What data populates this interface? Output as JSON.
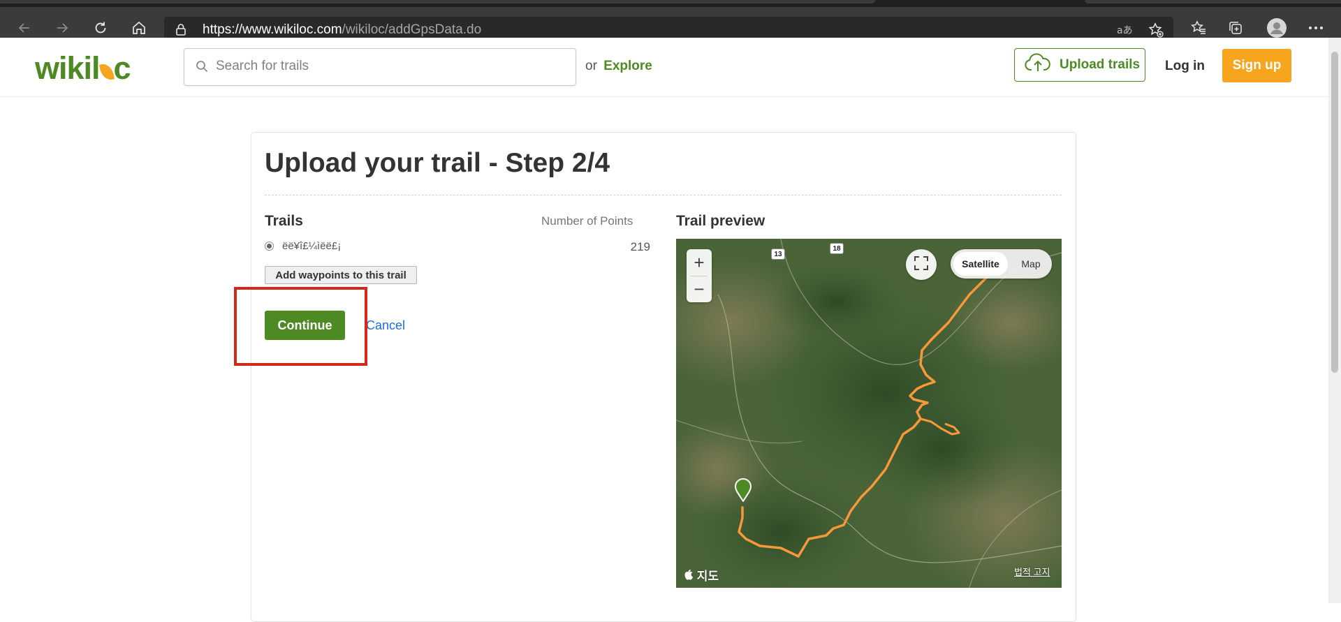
{
  "browser": {
    "url_main": "https://www.wikiloc.com",
    "url_path": "/wikiloc/addGpsData.do",
    "icons": [
      "back-icon",
      "forward-icon",
      "refresh-icon",
      "home-icon",
      "lock-icon",
      "read-aloud-icon",
      "add-favorite-icon",
      "favorites-icon",
      "collections-icon",
      "profile-icon",
      "more-icon"
    ]
  },
  "header": {
    "logo_text": "wikiloc",
    "search_placeholder": "Search for trails",
    "or_text": "or",
    "explore_label": "Explore",
    "upload_label": "Upload trails",
    "login_label": "Log in",
    "signup_label": "Sign up"
  },
  "page": {
    "title": "Upload your trail - Step 2/4",
    "trails_heading": "Trails",
    "points_heading": "Number of Points",
    "trails": [
      {
        "name": "ëë¥î£¼ìëë£¡",
        "points": "219",
        "selected": true
      }
    ],
    "add_waypoints_label": "Add waypoints to this trail",
    "continue_label": "Continue",
    "cancel_label": "Cancel",
    "preview_heading": "Trail preview"
  },
  "map": {
    "zoom_in": "+",
    "zoom_out": "−",
    "satellite_label": "Satellite",
    "map_label": "Map",
    "road_13": "13",
    "road_18": "18",
    "attribution": "지도",
    "legal": "법적 고지"
  },
  "colors": {
    "brand_green": "#4e8a24",
    "brand_orange": "#f7a51c",
    "cancel_blue": "#1e6fd2",
    "highlight_red": "#d12a1b",
    "trail_orange": "#f7983a"
  }
}
